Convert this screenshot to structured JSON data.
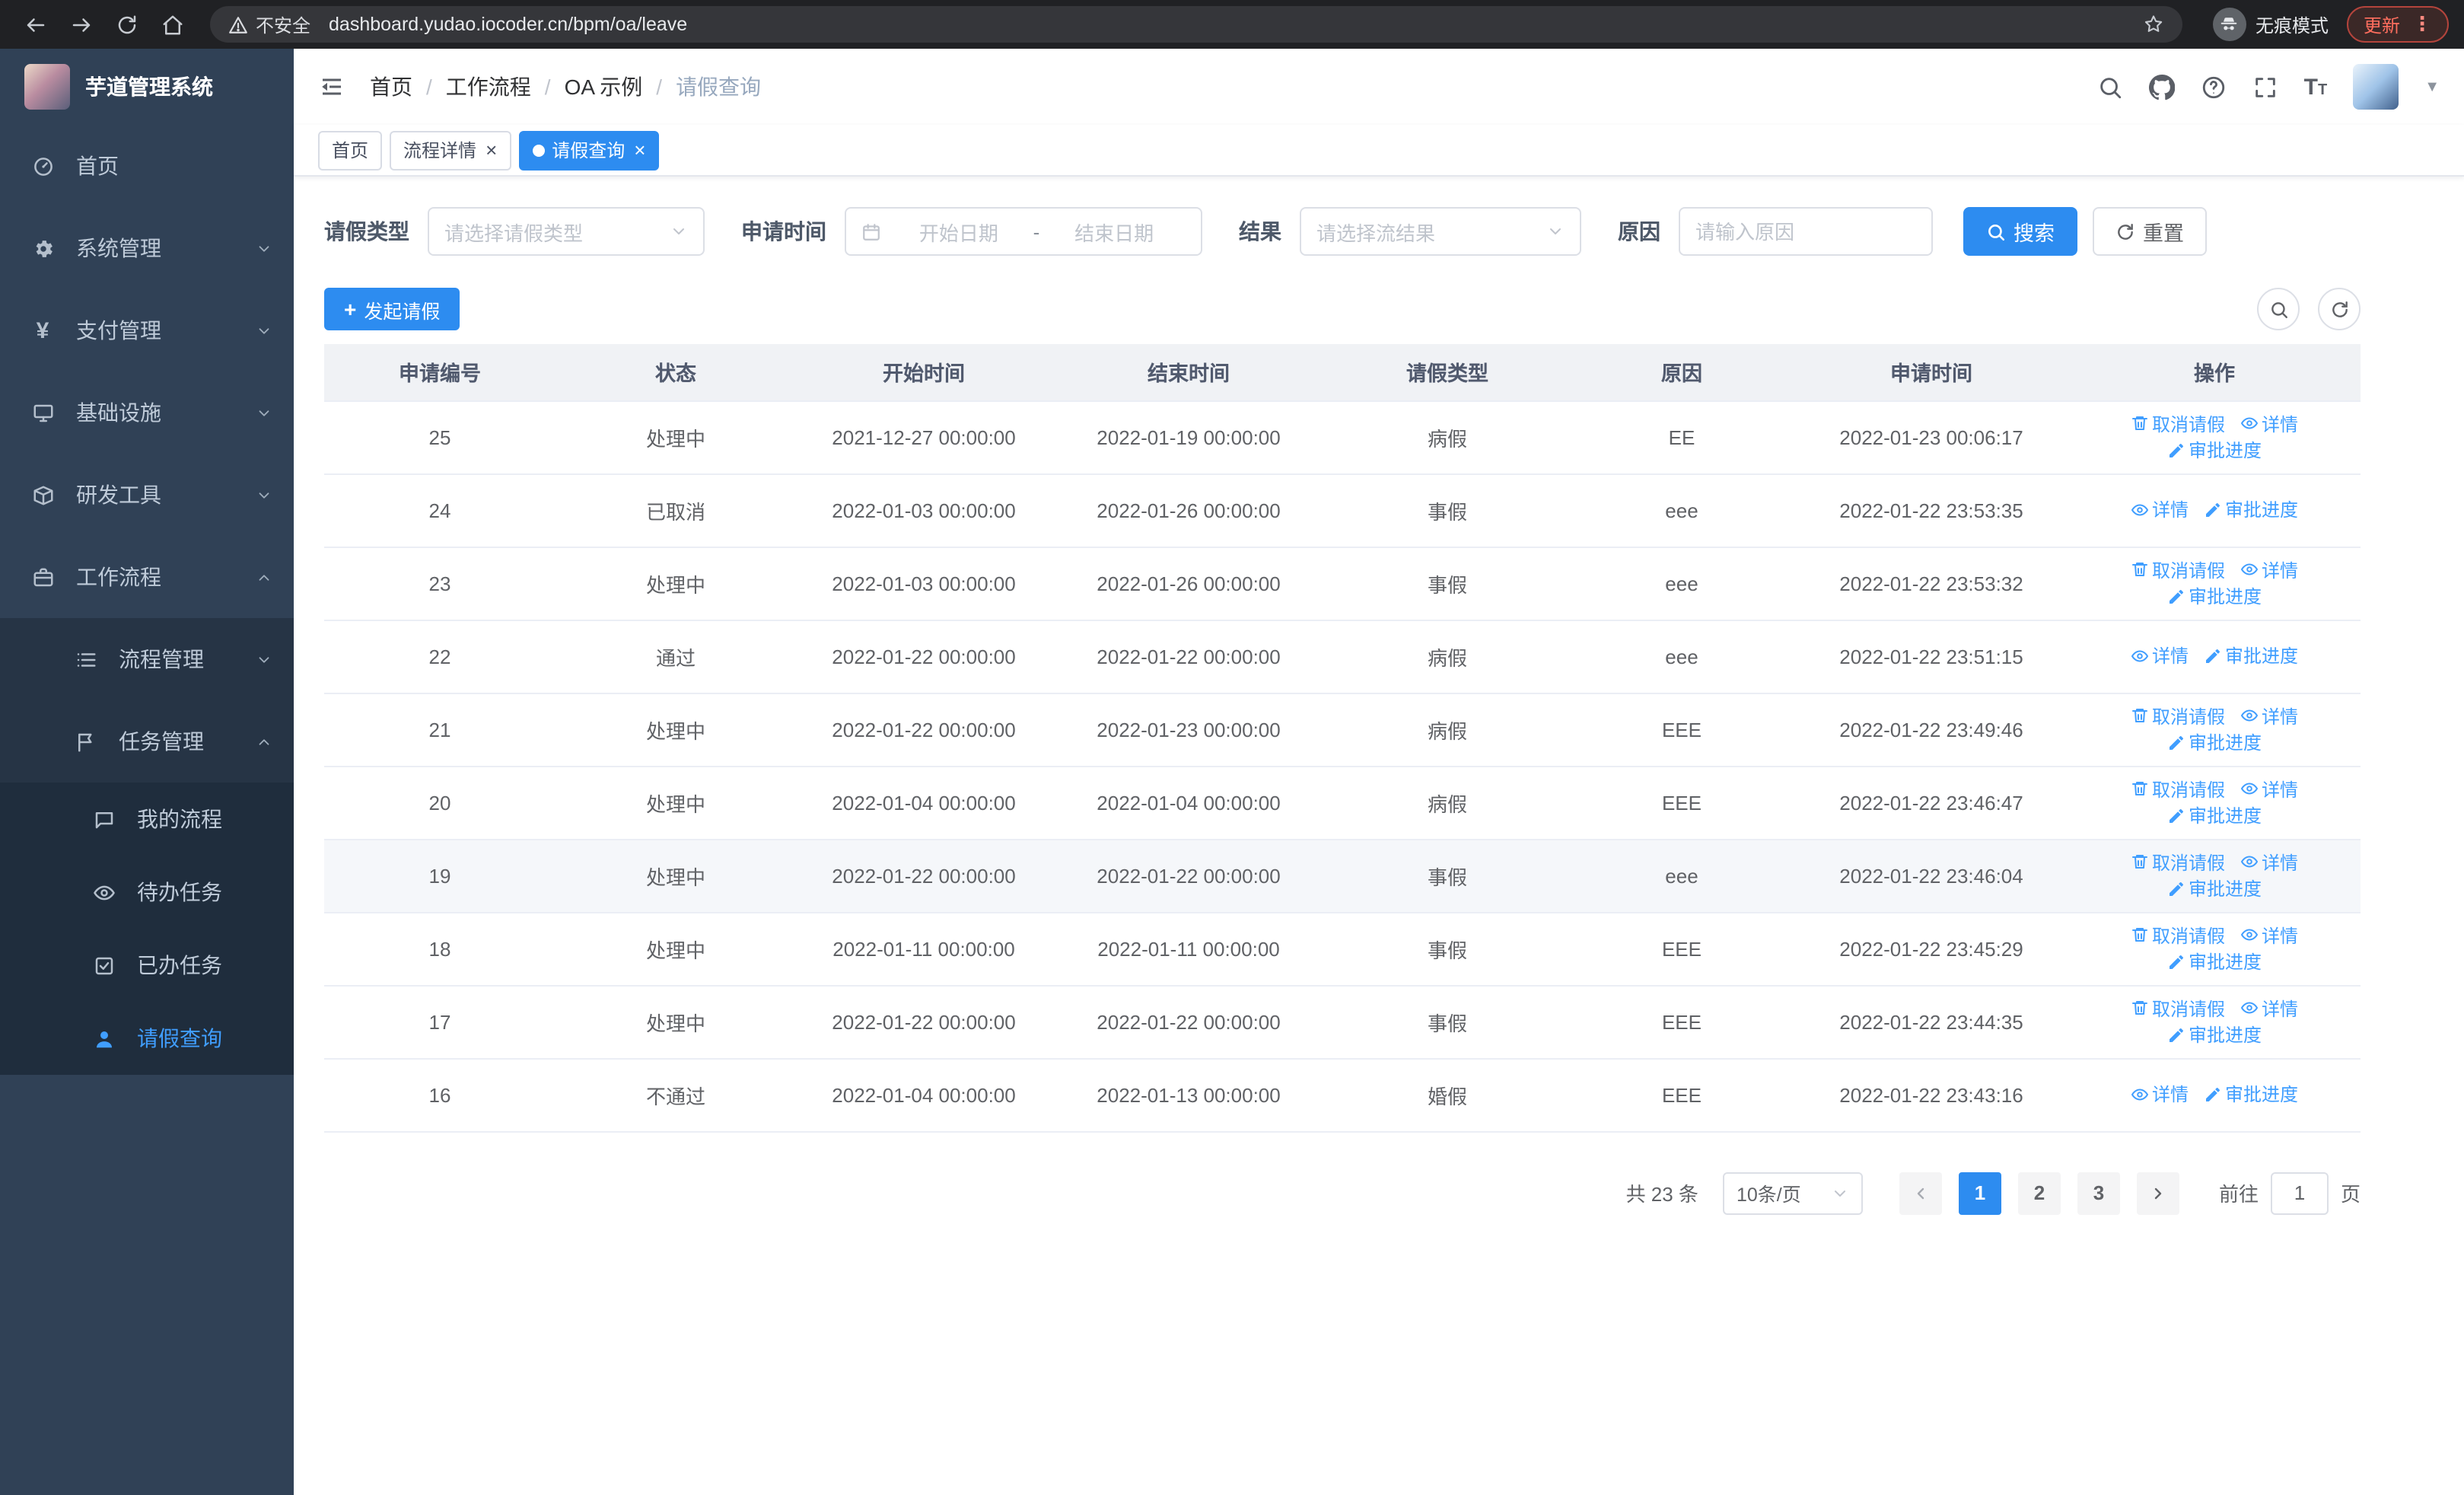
{
  "browser": {
    "security_label": "不安全",
    "url": "dashboard.yudao.iocoder.cn/bpm/oa/leave",
    "incognito_label": "无痕模式",
    "update_label": "更新"
  },
  "sidebar": {
    "app_title": "芋道管理系统",
    "items": [
      {
        "label": "首页",
        "icon": "dashboard-icon",
        "level": 1
      },
      {
        "label": "系统管理",
        "icon": "gear-icon",
        "level": 1,
        "arrow": "down"
      },
      {
        "label": "支付管理",
        "icon": "yen-icon",
        "level": 1,
        "arrow": "down"
      },
      {
        "label": "基础设施",
        "icon": "monitor-icon",
        "level": 1,
        "arrow": "down"
      },
      {
        "label": "研发工具",
        "icon": "box-icon",
        "level": 1,
        "arrow": "down"
      },
      {
        "label": "工作流程",
        "icon": "briefcase-icon",
        "level": 1,
        "arrow": "up"
      },
      {
        "label": "流程管理",
        "icon": "list-icon",
        "level": 2,
        "arrow": "down"
      },
      {
        "label": "任务管理",
        "icon": "flag-icon",
        "level": 2,
        "arrow": "up"
      },
      {
        "label": "我的流程",
        "icon": "chat-icon",
        "level": 3
      },
      {
        "label": "待办任务",
        "icon": "eye-icon",
        "level": 3
      },
      {
        "label": "已办任务",
        "icon": "check-square-icon",
        "level": 3
      },
      {
        "label": "请假查询",
        "icon": "user-icon",
        "level": 3,
        "active": true
      }
    ]
  },
  "breadcrumb": {
    "items": [
      "首页",
      "工作流程",
      "OA 示例",
      "请假查询"
    ]
  },
  "tags": [
    {
      "label": "首页",
      "closable": false,
      "active": false
    },
    {
      "label": "流程详情",
      "closable": true,
      "active": false
    },
    {
      "label": "请假查询",
      "closable": true,
      "active": true
    }
  ],
  "filters": {
    "leave_type_label": "请假类型",
    "leave_type_placeholder": "请选择请假类型",
    "apply_time_label": "申请时间",
    "date_start_placeholder": "开始日期",
    "date_separator": "-",
    "date_end_placeholder": "结束日期",
    "result_label": "结果",
    "result_placeholder": "请选择流结果",
    "reason_label": "原因",
    "reason_placeholder": "请输入原因",
    "search_label": "搜索",
    "reset_label": "重置"
  },
  "toolbar": {
    "create_label": "发起请假"
  },
  "table": {
    "columns": [
      "申请编号",
      "状态",
      "开始时间",
      "结束时间",
      "请假类型",
      "原因",
      "申请时间",
      "操作"
    ],
    "actions": {
      "cancel": "取消请假",
      "detail": "详情",
      "progress": "审批进度"
    },
    "rows": [
      {
        "id": "25",
        "status": "处理中",
        "start": "2021-12-27 00:00:00",
        "end": "2022-01-19 00:00:00",
        "type": "病假",
        "reason": "EE",
        "applied": "2022-01-23 00:06:17",
        "cancelable": true
      },
      {
        "id": "24",
        "status": "已取消",
        "start": "2022-01-03 00:00:00",
        "end": "2022-01-26 00:00:00",
        "type": "事假",
        "reason": "eee",
        "applied": "2022-01-22 23:53:35",
        "cancelable": false
      },
      {
        "id": "23",
        "status": "处理中",
        "start": "2022-01-03 00:00:00",
        "end": "2022-01-26 00:00:00",
        "type": "事假",
        "reason": "eee",
        "applied": "2022-01-22 23:53:32",
        "cancelable": true
      },
      {
        "id": "22",
        "status": "通过",
        "start": "2022-01-22 00:00:00",
        "end": "2022-01-22 00:00:00",
        "type": "病假",
        "reason": "eee",
        "applied": "2022-01-22 23:51:15",
        "cancelable": false
      },
      {
        "id": "21",
        "status": "处理中",
        "start": "2022-01-22 00:00:00",
        "end": "2022-01-23 00:00:00",
        "type": "病假",
        "reason": "EEE",
        "applied": "2022-01-22 23:49:46",
        "cancelable": true
      },
      {
        "id": "20",
        "status": "处理中",
        "start": "2022-01-04 00:00:00",
        "end": "2022-01-04 00:00:00",
        "type": "病假",
        "reason": "EEE",
        "applied": "2022-01-22 23:46:47",
        "cancelable": true
      },
      {
        "id": "19",
        "status": "处理中",
        "start": "2022-01-22 00:00:00",
        "end": "2022-01-22 00:00:00",
        "type": "事假",
        "reason": "eee",
        "applied": "2022-01-22 23:46:04",
        "cancelable": true,
        "highlighted": true
      },
      {
        "id": "18",
        "status": "处理中",
        "start": "2022-01-11 00:00:00",
        "end": "2022-01-11 00:00:00",
        "type": "事假",
        "reason": "EEE",
        "applied": "2022-01-22 23:45:29",
        "cancelable": true
      },
      {
        "id": "17",
        "status": "处理中",
        "start": "2022-01-22 00:00:00",
        "end": "2022-01-22 00:00:00",
        "type": "事假",
        "reason": "EEE",
        "applied": "2022-01-22 23:44:35",
        "cancelable": true
      },
      {
        "id": "16",
        "status": "不通过",
        "start": "2022-01-04 00:00:00",
        "end": "2022-01-13 00:00:00",
        "type": "婚假",
        "reason": "EEE",
        "applied": "2022-01-22 23:43:16",
        "cancelable": false
      }
    ]
  },
  "pagination": {
    "total_label": "共 23 条",
    "page_size": "10条/页",
    "pages": [
      "1",
      "2",
      "3"
    ],
    "active_page": "1",
    "goto_label": "前往",
    "goto_value": "1",
    "page_suffix": "页"
  }
}
